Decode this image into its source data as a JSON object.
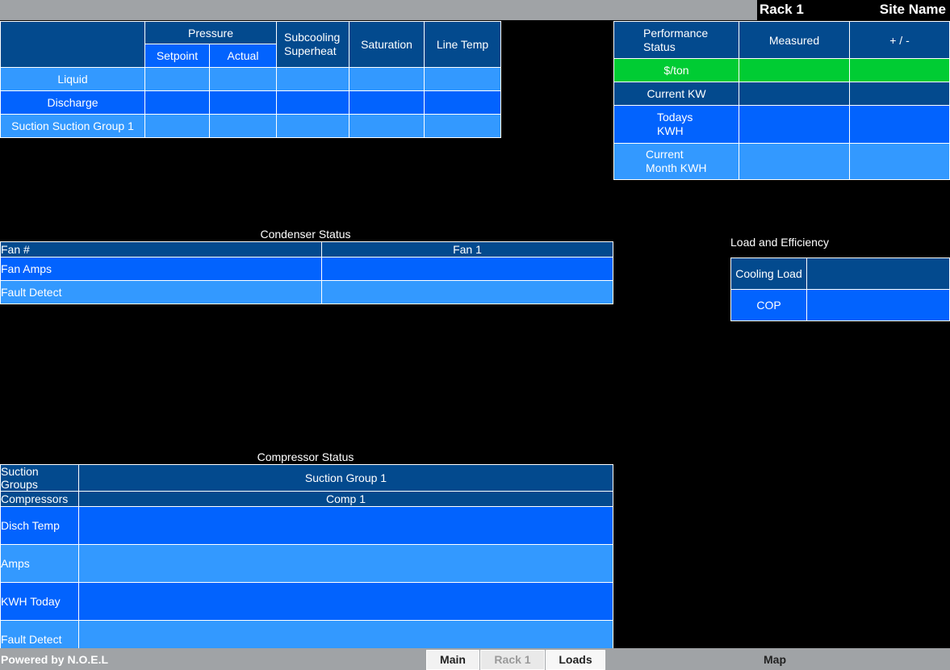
{
  "header": {
    "rack": "Rack 1",
    "site": "Site Name"
  },
  "pressure_table": {
    "col_pressure": "Pressure",
    "col_setpoint": "Setpoint",
    "col_actual": "Actual",
    "col_subcooling": "Subcooling",
    "col_superheat": "Superheat",
    "col_saturation": "Saturation",
    "col_linetemp": "Line Temp",
    "rows": [
      "Liquid",
      "Discharge",
      "Suction Suction Group 1"
    ]
  },
  "performance": {
    "col_status_1": "Performance",
    "col_status_2": "Status",
    "col_measured": "Measured",
    "col_plusminus": "+ / -",
    "rows": [
      {
        "l1": "$/ton",
        "l2": ""
      },
      {
        "l1": "Current KW",
        "l2": ""
      },
      {
        "l1": "Todays",
        "l2": "KWH"
      },
      {
        "l1": "Current",
        "l2": "Month KWH"
      }
    ]
  },
  "condenser": {
    "title": "Condenser Status",
    "fan_label": "Fan #",
    "fan1": "Fan 1",
    "rows": [
      "Fan Amps",
      "Fault Detect"
    ]
  },
  "load_eff": {
    "title": "Load and Efficiency",
    "rows": [
      "Cooling Load",
      "COP"
    ]
  },
  "compressor": {
    "title": "Compressor Status",
    "suction_groups_label": "Suction Groups",
    "suction_group_1": "Suction Group 1",
    "compressors_label": "Compressors",
    "comp1": "Comp 1",
    "rows": [
      "Disch Temp",
      "Amps",
      "KWH Today",
      "Fault Detect"
    ]
  },
  "footer": {
    "powered": "Powered by N.O.E.L",
    "main": "Main",
    "rack": "Rack 1",
    "loads": "Loads",
    "map": "Map"
  },
  "colors": {
    "dark_blue": "#034a8e",
    "mid_blue": "#0263fe",
    "light_blue": "#3399ff",
    "green": "#00cc33",
    "gray": "#a0a3a6"
  }
}
